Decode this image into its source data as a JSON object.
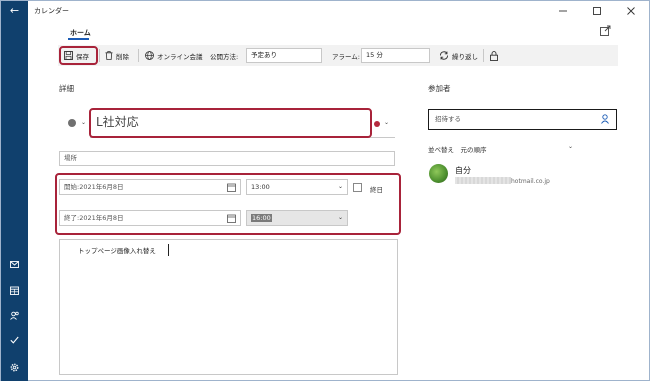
{
  "window": {
    "title": "カレンダー"
  },
  "ribbon": {
    "tab_home": "ホーム"
  },
  "toolbar": {
    "save": "保存",
    "delete": "削除",
    "online_meeting": "オンライン会議",
    "show_as_label": "公開方法:",
    "show_as_value": "予定あり",
    "reminder_label": "アラーム:",
    "reminder_value": "15 分",
    "repeat": "繰り返し"
  },
  "details": {
    "heading": "詳細",
    "subject": "L社対応",
    "location_placeholder": "場所",
    "start_label": "開始:",
    "start_date": "2021年6月8日",
    "start_time": "13:00",
    "all_day": "終日",
    "end_label": "終了:",
    "end_date": "2021年6月8日",
    "end_time": "16:00",
    "body": "トップページ画像入れ替え"
  },
  "attendees": {
    "heading": "参加者",
    "invite_placeholder": "招待する",
    "sort_label": "並べ替え　元の順序",
    "person_name": "自分",
    "person_email": "hotmail.co.jp"
  },
  "colors": {
    "accent": "#1a5bb5",
    "rail": "#10406d",
    "highlight": "#a8233a",
    "event_color": "#b52a3f"
  }
}
